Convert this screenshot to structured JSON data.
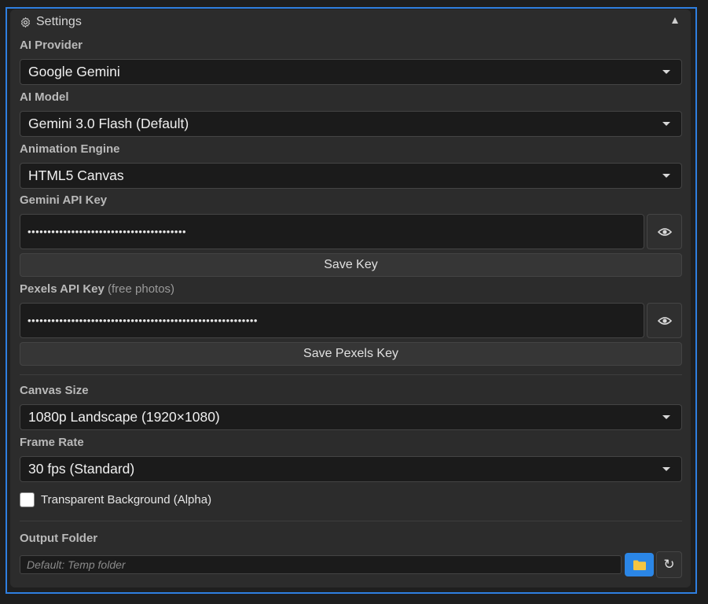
{
  "header": {
    "title": "Settings",
    "icon": "gear-icon",
    "collapse_icon": "triangle-up-icon"
  },
  "ai_provider": {
    "label": "AI Provider",
    "value": "Google Gemini"
  },
  "ai_model": {
    "label": "AI Model",
    "value": "Gemini 3.0 Flash (Default)"
  },
  "animation_engine": {
    "label": "Animation Engine",
    "value": "HTML5 Canvas"
  },
  "gemini_key": {
    "label": "Gemini API Key",
    "masked_value": "••••••••••••••••••••••••••••••••••••••••",
    "reveal_icon": "eye-icon",
    "save_label": "Save Key"
  },
  "pexels_key": {
    "label": "Pexels API Key",
    "label_note": "(free photos)",
    "masked_value": "••••••••••••••••••••••••••••••••••••••••••••••••••••••••••",
    "reveal_icon": "eye-icon",
    "save_label": "Save Pexels Key"
  },
  "canvas_size": {
    "label": "Canvas Size",
    "value": "1080p Landscape (1920×1080)"
  },
  "frame_rate": {
    "label": "Frame Rate",
    "value": "30 fps (Standard)"
  },
  "transparent_bg": {
    "label": "Transparent Background (Alpha)",
    "checked": false
  },
  "output_folder": {
    "label": "Output Folder",
    "placeholder": "Default: Temp folder",
    "browse_icon": "folder-icon",
    "reset_icon": "refresh-icon",
    "reset_glyph": "↻"
  },
  "colors": {
    "accent": "#2b86e6",
    "panel": "#2c2c2c",
    "field": "#1b1b1b",
    "folder_icon": "#f5c542"
  }
}
